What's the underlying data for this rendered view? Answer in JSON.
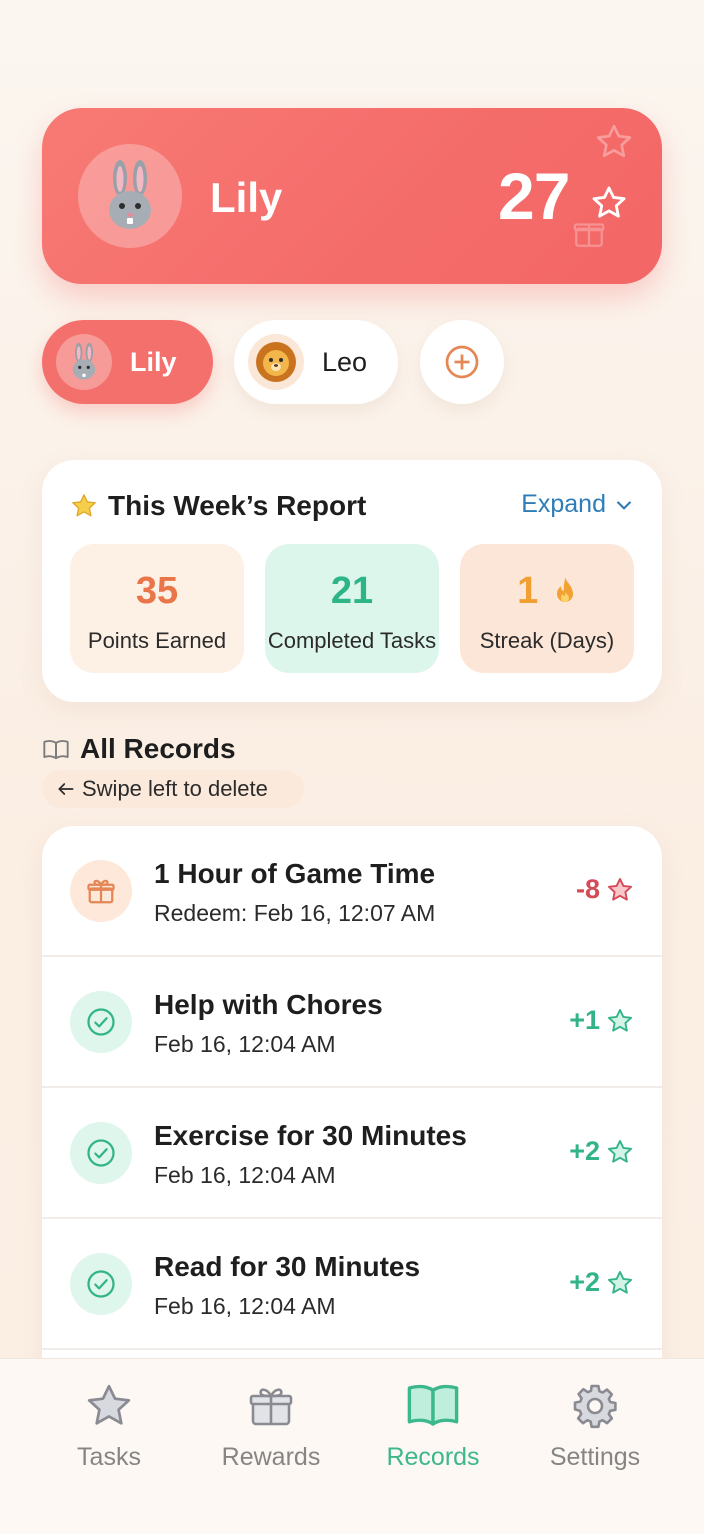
{
  "colors": {
    "brand_coral": "#f4706c",
    "points_orange": "#ea7548",
    "success_green": "#2db487",
    "streak_amber": "#f0a033",
    "link_blue": "#2e7db8",
    "negative_red": "#d44a57"
  },
  "hero": {
    "name": "Lily",
    "points": "27",
    "avatar_icon": "bunny-icon"
  },
  "profiles": [
    {
      "name": "Lily",
      "icon": "bunny-icon",
      "selected": true
    },
    {
      "name": "Leo",
      "icon": "lion-icon",
      "selected": false
    }
  ],
  "add_profile_icon": "plus-circle-icon",
  "report": {
    "title": "This Week’s Report",
    "expand_label": "Expand",
    "stats": [
      {
        "value": "35",
        "label": "Points Earned"
      },
      {
        "value": "21",
        "label": "Completed Tasks"
      },
      {
        "value": "1",
        "label": "Streak (Days)",
        "icon": "flame-icon"
      }
    ]
  },
  "records": {
    "title": "All Records",
    "hint": "Swipe left to delete",
    "items": [
      {
        "name": "1 Hour of Game Time",
        "date": "Redeem: Feb 16, 12:07 AM",
        "points": "-8",
        "type": "redeem",
        "icon": "gift-icon"
      },
      {
        "name": "Help with Chores",
        "date": "Feb 16, 12:04 AM",
        "points": "+1",
        "type": "done",
        "icon": "check-circle-icon"
      },
      {
        "name": "Exercise for 30 Minutes",
        "date": "Feb 16, 12:04 AM",
        "points": "+2",
        "type": "done",
        "icon": "check-circle-icon"
      },
      {
        "name": "Read for 30 Minutes",
        "date": "Feb 16, 12:04 AM",
        "points": "+2",
        "type": "done",
        "icon": "check-circle-icon"
      }
    ]
  },
  "tabs": [
    {
      "label": "Tasks",
      "icon": "star-icon",
      "active": false
    },
    {
      "label": "Rewards",
      "icon": "gift-icon",
      "active": false
    },
    {
      "label": "Records",
      "icon": "book-icon",
      "active": true
    },
    {
      "label": "Settings",
      "icon": "gear-icon",
      "active": false
    }
  ]
}
